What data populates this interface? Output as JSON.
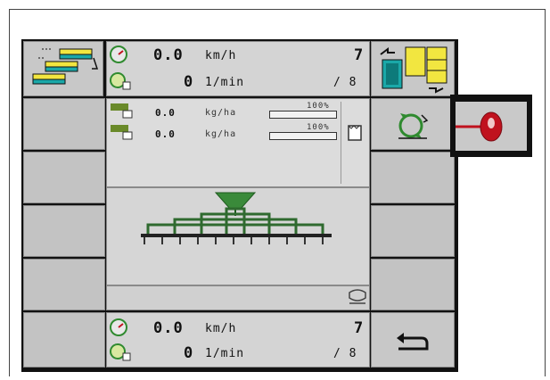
{
  "top_speed": {
    "value": "0.0",
    "unit": "km/h"
  },
  "top_rpm": {
    "value": "0",
    "unit": "1/min"
  },
  "top_counter": {
    "current": "7",
    "total": "/ 8"
  },
  "rates": [
    {
      "value": "0.0",
      "unit": "kg/ha",
      "percent": "100%"
    },
    {
      "value": "0.0",
      "unit": "kg/ha",
      "percent": "100%"
    }
  ],
  "bottom_speed": {
    "value": "0.0",
    "unit": "km/h"
  },
  "bottom_rpm": {
    "value": "0",
    "unit": "1/min"
  },
  "bottom_counter": {
    "current": "7",
    "total": "/ 8"
  },
  "icons": {
    "top_left": "section-layout-icon",
    "top_right": "section-switch-icon",
    "refresh": "refresh-icon",
    "back": "back-arrow-icon",
    "hitch": "hitch-icon",
    "popup": "joystick-button-icon"
  },
  "colors": {
    "accent_green": "#3a8a3a",
    "accent_yellow": "#f2e640",
    "accent_teal": "#1aa8a8",
    "popup_red": "#c0121e"
  }
}
